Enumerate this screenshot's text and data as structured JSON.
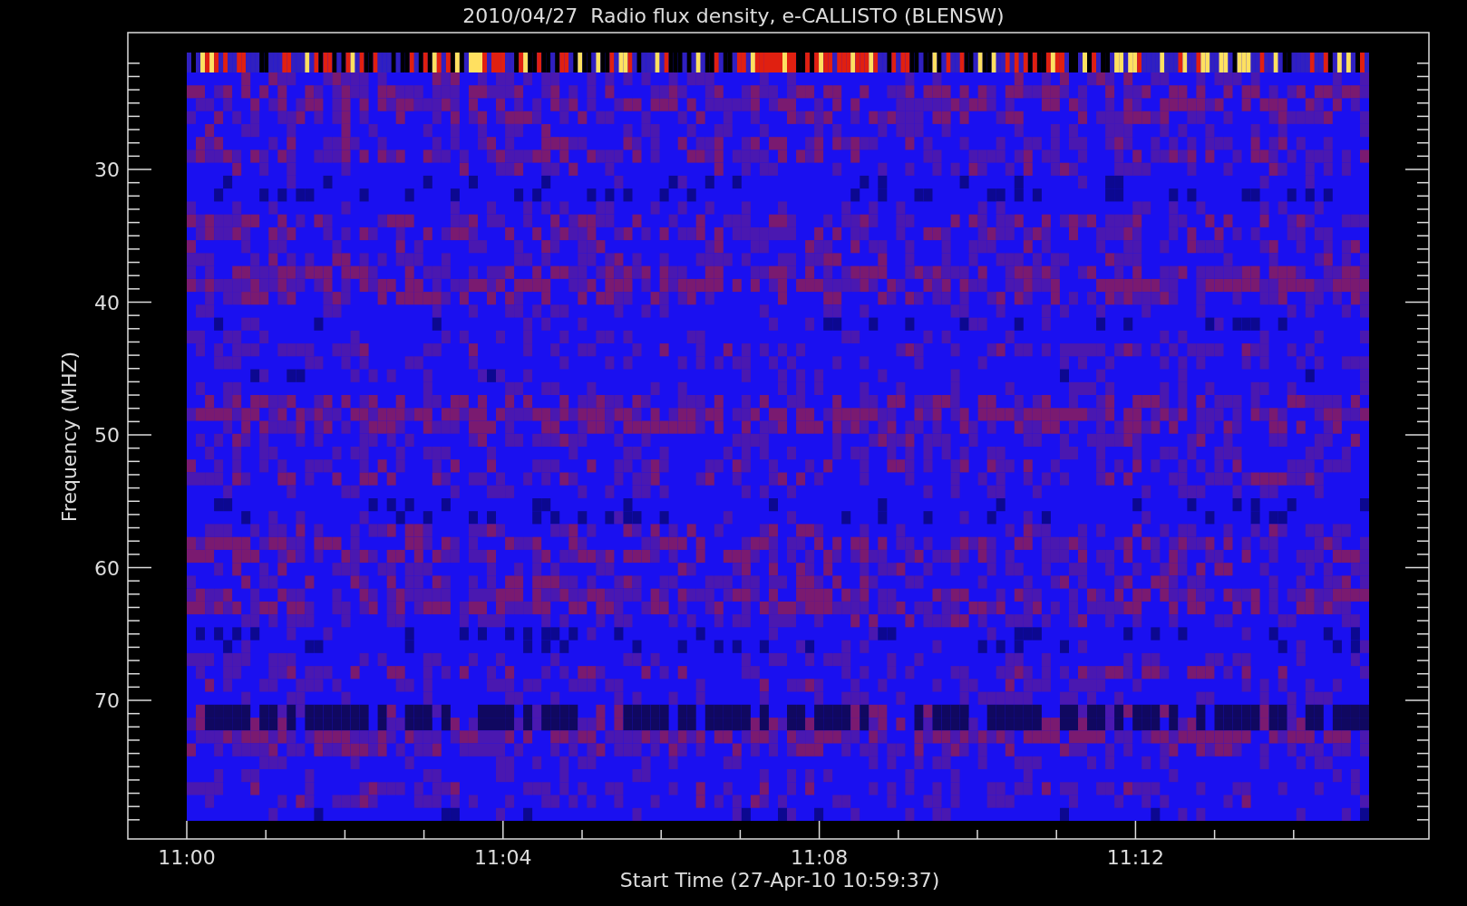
{
  "chart": {
    "title": "2010/04/27  Radio flux density, e-CALLISTO (BLENSW)",
    "ylabel": "Frequency (MHZ)",
    "xlabel": "Start Time (27-Apr-10 10:59:37)",
    "yticks": [
      "30",
      "40",
      "50",
      "60",
      "70"
    ],
    "xticks": [
      "11:00",
      "11:04",
      "11:08",
      "11:12"
    ]
  }
}
